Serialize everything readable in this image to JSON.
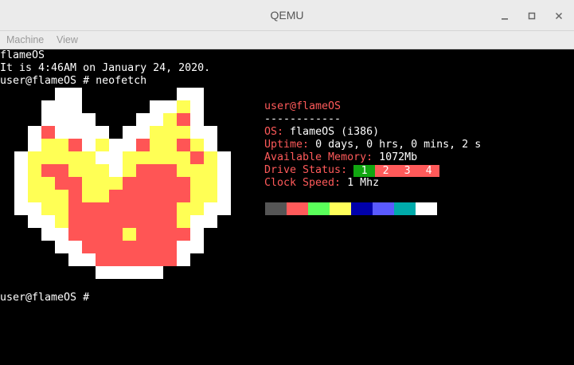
{
  "window": {
    "title": "QEMU",
    "controls": [
      "minimize-icon",
      "maximize-icon",
      "close-icon"
    ]
  },
  "menu": {
    "items": [
      "Machine",
      "View"
    ]
  },
  "terminal": {
    "lines": [
      "flameOS",
      "It is 4:46AM on January 24, 2020.",
      "user@flameOS # neofetch"
    ],
    "prompt": "user@flameOS #"
  },
  "neofetch": {
    "user_host": "user@flameOS",
    "separator": "------------",
    "os_label": "OS:",
    "os_value": "flameOS (i386)",
    "uptime_label": "Uptime:",
    "uptime_value": "0 days, 0 hrs, 0 mins, 2 s",
    "memory_label": "Available Memory:",
    "memory_value": "1072Mb",
    "drive_label": "Drive Status:",
    "drives": [
      {
        "label": "1",
        "color": "#11a611"
      },
      {
        "label": "2",
        "color": "#ff5a5a"
      },
      {
        "label": "3",
        "color": "#ff5a5a"
      },
      {
        "label": "4",
        "color": "#ff5a5a"
      }
    ],
    "clock_label": "Clock Speed:",
    "clock_value": "1 Mhz",
    "palette": [
      "#555555",
      "#ff5a5a",
      "#5aff5a",
      "#ffff5a",
      "#0000aa",
      "#5a5aff",
      "#00aaaa",
      "#ffffff"
    ]
  },
  "logo": {
    "name": "flame-heart-logo",
    "colors": {
      "W": "#ffffff",
      "Y": "#ffff55",
      "R": "#ff5555"
    },
    "pixels": [
      "...WW.......WW..",
      "..WWW.....WWYW..",
      "..WWWW...WWYRW..",
      ".WRWWWW.WWYYYWW.",
      ".WYYRWYWWRYYRYW.",
      "WYYYYYWWYYYYYRYW",
      "WYRRYYYWYRRRYYYW",
      "WYYRRYYYRRRRRYYW",
      "WYYYRYYRRRRRRYYW",
      "WWYYRRRRRRRRYYWW",
      ".WWYRRRRRRRRYWW.",
      "..WWRRRRYRRRRW..",
      "...WWRRRRRRRWW..",
      "....WWRRRRRRW...",
      "......WWWWW....."
    ]
  }
}
